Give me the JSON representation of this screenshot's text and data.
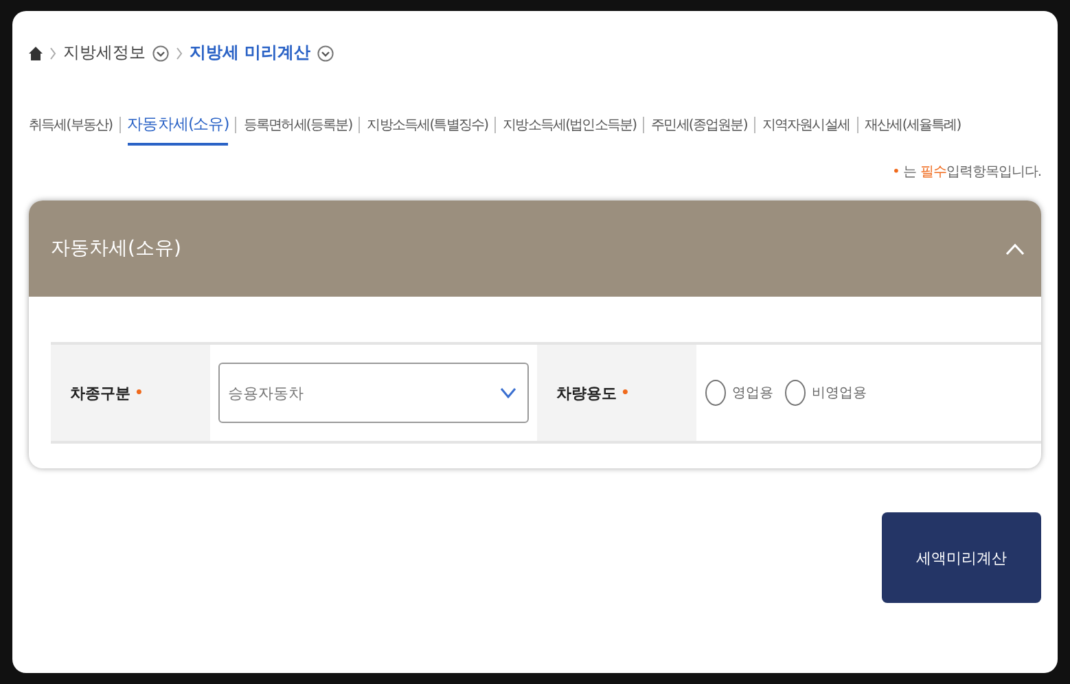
{
  "breadcrumb": [
    {
      "label": "지방세정보",
      "current": false
    },
    {
      "label": "지방세 미리계산",
      "current": true
    }
  ],
  "tabs": [
    {
      "label": "취득세(부동산)",
      "selected": false
    },
    {
      "label": "자동차세(소유)",
      "selected": true
    },
    {
      "label": "등록면허세(등록분)",
      "selected": false
    },
    {
      "label": "지방소득세(특별징수)",
      "selected": false
    },
    {
      "label": "지방소득세(법인소득분)",
      "selected": false
    },
    {
      "label": "주민세(종업원분)",
      "selected": false
    },
    {
      "label": "지역자원시설세",
      "selected": false
    },
    {
      "label": "재산세(세율특례)",
      "selected": false
    }
  ],
  "required_note": {
    "mark": "•",
    "before": "는 ",
    "highlight": "필수",
    "after": "입력항목입니다."
  },
  "panel": {
    "title": "자동차세(소유)",
    "expanded": true,
    "fields": [
      {
        "kind": "select",
        "label": "차종구분",
        "required_mark": "•",
        "value": "승용자동차"
      },
      {
        "kind": "radio",
        "label": "차량용도",
        "required_mark": "•",
        "options": [
          {
            "label": "영업용",
            "selected": false
          },
          {
            "label": "비영업용",
            "selected": false
          }
        ]
      }
    ]
  },
  "buttons": [
    "세액미리계산"
  ]
}
